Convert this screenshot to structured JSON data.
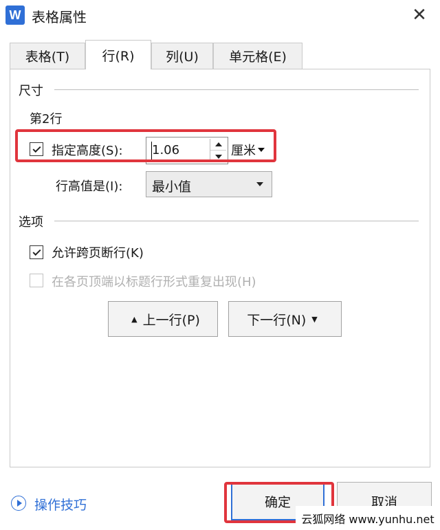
{
  "window": {
    "app_icon_letter": "W",
    "title": "表格属性",
    "close_symbol": "✕"
  },
  "tabs": [
    {
      "label": "表格(T)",
      "active": false
    },
    {
      "label": "行(R)",
      "active": true
    },
    {
      "label": "列(U)",
      "active": false
    },
    {
      "label": "单元格(E)",
      "active": false
    }
  ],
  "size_group": {
    "label": "尺寸",
    "row_label": "第2行",
    "specify_height": {
      "label": "指定高度(S):",
      "checked": true
    },
    "height_value": "1.06",
    "unit": "厘米",
    "row_height_is": {
      "label": "行高值是(I):",
      "value": "最小值"
    }
  },
  "options_group": {
    "label": "选项",
    "allow_break": {
      "label": "允许跨页断行(K)",
      "checked": true
    },
    "repeat_header": {
      "label": "在各页顶端以标题行形式重复出现(H)",
      "checked": false,
      "disabled": true
    }
  },
  "nav": {
    "prev_label": "上一行(P)",
    "next_label": "下一行(N)"
  },
  "footer": {
    "help_label": "操作技巧",
    "ok_label": "确定",
    "cancel_label": "取消"
  },
  "watermark": "云狐网络 www.yunhu.net",
  "colors": {
    "accent": "#2f6fd6",
    "highlight": "#e0353d"
  }
}
